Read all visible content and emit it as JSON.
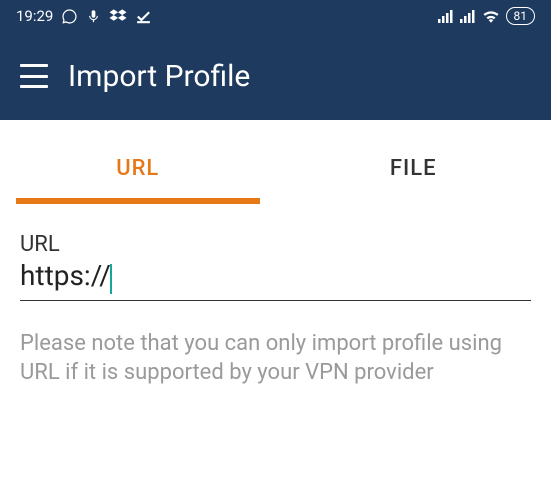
{
  "statusBar": {
    "time": "19:29",
    "battery": "81"
  },
  "appBar": {
    "title": "Import Profile"
  },
  "tabs": {
    "url": "URL",
    "file": "FILE"
  },
  "form": {
    "urlLabel": "URL",
    "urlValue": "https://",
    "helpText": "Please note that you can only import profile using URL if it is supported by your VPN provider"
  }
}
